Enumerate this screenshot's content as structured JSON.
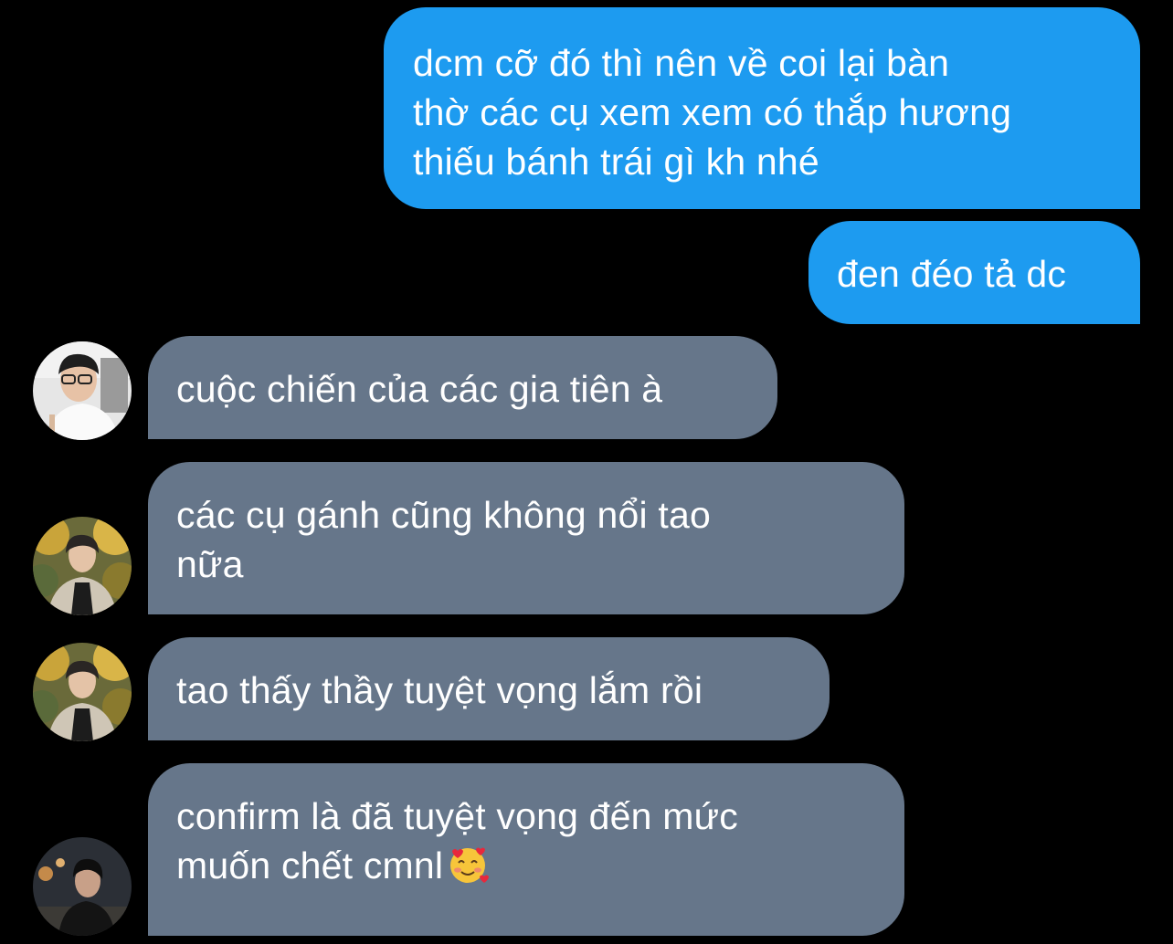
{
  "colors": {
    "background": "#000000",
    "sent_bubble": "#1d9bf0",
    "received_bubble": "#66768a",
    "text": "#ffffff"
  },
  "messages": [
    {
      "direction": "sent",
      "text": "dcm cỡ đó thì nên về coi lại bàn\nthờ các cụ xem xem có thắp hương\nthiếu bánh trái gì kh nhé"
    },
    {
      "direction": "sent",
      "text": "đen đéo tả dc"
    },
    {
      "direction": "received",
      "text": "cuộc chiến của các gia tiên à",
      "avatar": "avatar-white-shirt-person"
    },
    {
      "direction": "received",
      "text": "các cụ gánh cũng không nổi tao\nnữa",
      "avatar": "avatar-autumn-person"
    },
    {
      "direction": "received",
      "text": "tao thấy thầy tuyệt vọng lắm rồi",
      "avatar": "avatar-autumn-person"
    },
    {
      "direction": "received",
      "text": "confirm là đã tuyệt vọng đến mức\nmuốn chết cmnl",
      "emoji": "smiling-face-with-hearts",
      "avatar": "avatar-dark-night-person"
    }
  ]
}
